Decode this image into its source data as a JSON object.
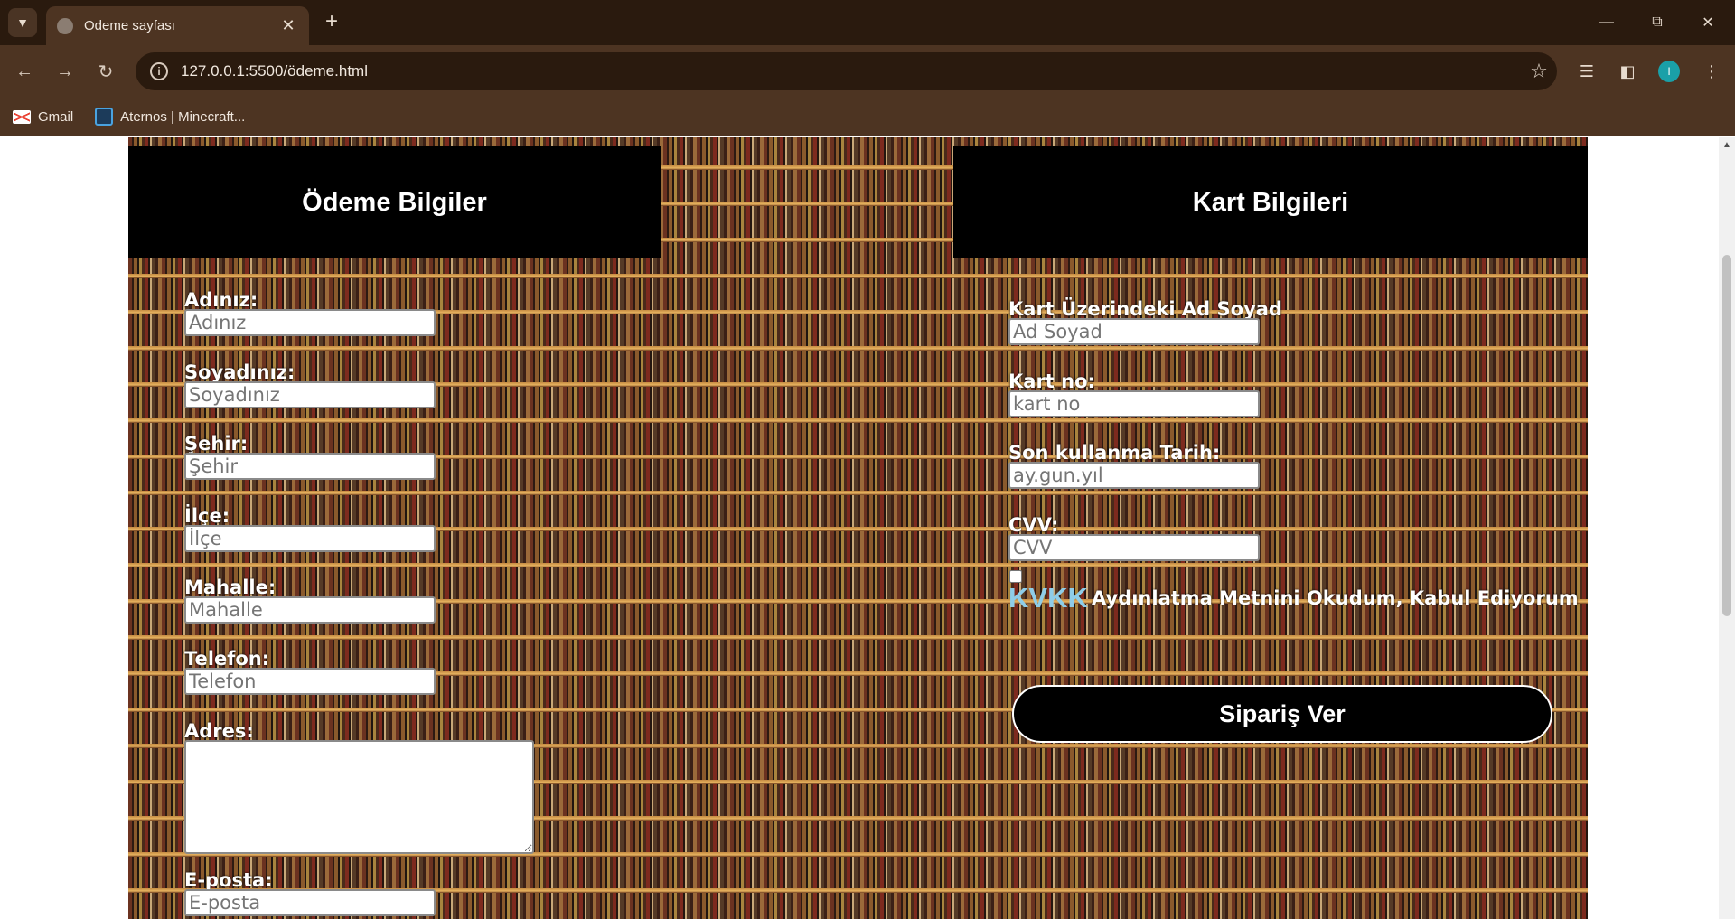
{
  "browser": {
    "tab_title": "Odeme sayfası",
    "url": "127.0.0.1:5500/ödeme.html",
    "profile_initial": "I",
    "bookmarks": [
      {
        "label": "Gmail",
        "icon": "gmail-icon"
      },
      {
        "label": "Aternos | Minecraft...",
        "icon": "aternos-icon"
      }
    ]
  },
  "page": {
    "left_header": "Ödeme Bilgiler",
    "right_header": "Kart Bilgileri",
    "payment_fields": [
      {
        "label": "Adınız:",
        "placeholder": "Adınız"
      },
      {
        "label": "Soyadınız:",
        "placeholder": "Soyadınız"
      },
      {
        "label": "Şehir:",
        "placeholder": "Şehir"
      },
      {
        "label": "İlçe:",
        "placeholder": "İlçe"
      },
      {
        "label": "Mahalle:",
        "placeholder": "Mahalle"
      },
      {
        "label": "Telefon:",
        "placeholder": "Telefon"
      },
      {
        "label": "Adres:"
      },
      {
        "label": "E-posta:",
        "placeholder": "E-posta"
      }
    ],
    "card_fields": [
      {
        "label": "Kart Üzerindeki Ad Soyad",
        "placeholder": "Ad Soyad"
      },
      {
        "label": "Kart no:",
        "placeholder": "kart no"
      },
      {
        "label": "Son kullanma Tarih:",
        "placeholder": "ay.gun.yıl"
      },
      {
        "label": "CVV:",
        "placeholder": "CVV"
      }
    ],
    "kvkk_link": "KVKK",
    "kvkk_text": "Aydınlatma Metnini Okudum, Kabul Ediyorum",
    "order_button": "Sipariş Ver"
  },
  "colors": {
    "header_bg": "#000000",
    "kvkk_link": "#8fcde8",
    "chrome_dark": "#2a1a0e",
    "chrome_mid": "#4d3422"
  }
}
